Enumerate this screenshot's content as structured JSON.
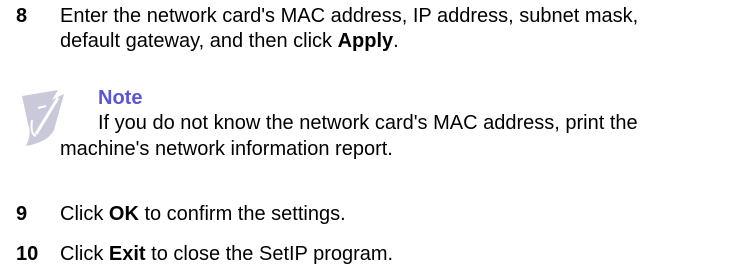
{
  "steps": [
    {
      "number": "8",
      "line1": "Enter the network card's MAC address, IP address, subnet mask,",
      "line2_prefix": "default gateway, and then click ",
      "line2_bold": "Apply",
      "line2_suffix": "."
    },
    {
      "number": "9",
      "prefix": "Click ",
      "bold": "OK",
      "suffix": " to confirm the settings."
    },
    {
      "number": "10",
      "prefix": "Click ",
      "bold": "Exit",
      "suffix": " to close the SetIP program."
    }
  ],
  "note": {
    "icon": "note-pencil-icon",
    "title": "Note",
    "line1": " If you do not know the network card's MAC address, print the",
    "line2": "machine's network information report."
  },
  "colors": {
    "note_title": "#5a56d6",
    "icon_fill": "#c9c9d9"
  }
}
